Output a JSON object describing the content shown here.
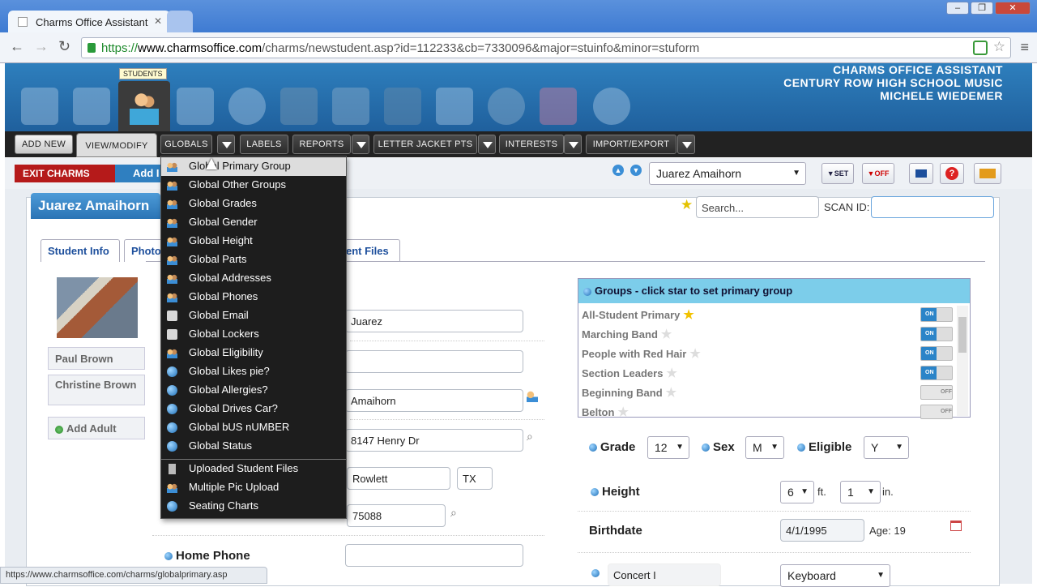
{
  "browser": {
    "tab_title": "Charms Office Assistant",
    "url_scheme": "https://",
    "url_host": "www.charmsoffice.com",
    "url_path": "/charms/newstudent.asp?id=112233&cb=7330096&major=stuinfo&minor=stuform"
  },
  "header": {
    "line1": "CHARMS OFFICE ASSISTANT",
    "line2": "CENTURY ROW HIGH SCHOOL MUSIC",
    "line3": "MICHELE WIEDEMER",
    "tooltip": "STUDENTS"
  },
  "nav": {
    "add_new": "ADD NEW",
    "view_modify": "VIEW/MODIFY",
    "globals": "GLOBALS",
    "labels": "LABELS",
    "reports": "REPORTS",
    "letter_jacket": "LETTER JACKET PTS",
    "interests": "INTERESTS",
    "import_export": "IMPORT/EXPORT"
  },
  "subbar": {
    "exit": "EXIT CHARMS",
    "add": "Add I",
    "student_select": "Juarez Amaihorn",
    "set_label": "SET",
    "off_label": "OFF"
  },
  "student": {
    "name": "Juarez Amaihorn",
    "search_placeholder": "Search...",
    "scan_label": "SCAN ID:"
  },
  "tabs": {
    "student_info": "Student Info",
    "photo": "Photo",
    "files": "ent Files"
  },
  "adults": {
    "a1": "Paul Brown",
    "a2": "Christine Brown",
    "add": "Add Adult"
  },
  "form": {
    "first_name": "Juarez",
    "last_name": "Amaihorn",
    "address": "8147 Henry Dr",
    "city": "Rowlett",
    "state": "TX",
    "zip": "75088",
    "home_phone_label": "Home Phone",
    "grade_label": "Grade",
    "grade": "12",
    "sex_label": "Sex",
    "sex": "M",
    "eligible_label": "Eligible",
    "eligible": "Y",
    "height_label": "Height",
    "height_ft": "6",
    "ft": "ft.",
    "height_in": "1",
    "in": "in.",
    "birthdate_label": "Birthdate",
    "birthdate": "4/1/1995",
    "age": "Age: 19",
    "concert": "Concert I",
    "instrument": "Keyboard"
  },
  "groups": {
    "header": "Groups - click star to set primary group",
    "on": "ON",
    "off": "OFF",
    "items": [
      {
        "name": "All-Student Primary",
        "primary": true,
        "on": true
      },
      {
        "name": "Marching Band",
        "primary": false,
        "on": true
      },
      {
        "name": "People with Red Hair",
        "primary": false,
        "on": true
      },
      {
        "name": "Section Leaders",
        "primary": false,
        "on": true
      },
      {
        "name": "Beginning Band",
        "primary": false,
        "on": false
      },
      {
        "name": "Belton",
        "primary": false,
        "on": false
      }
    ]
  },
  "menu": {
    "items": [
      {
        "label": "Global Primary Group",
        "icon": "group-icon"
      },
      {
        "label": "Global Other Groups",
        "icon": "group-icon"
      },
      {
        "label": "Global Grades",
        "icon": "group-icon"
      },
      {
        "label": "Global Gender",
        "icon": "group-icon"
      },
      {
        "label": "Global Height",
        "icon": "group-icon"
      },
      {
        "label": "Global Parts",
        "icon": "group-icon"
      },
      {
        "label": "Global Addresses",
        "icon": "group-icon"
      },
      {
        "label": "Global Phones",
        "icon": "group-icon"
      },
      {
        "label": "Global Email",
        "icon": "mail-icon"
      },
      {
        "label": "Global Lockers",
        "icon": "mail-icon"
      },
      {
        "label": "Global Eligibility",
        "icon": "group-icon"
      },
      {
        "label": "Global Likes pie?",
        "icon": "pin-icon"
      },
      {
        "label": "Global Allergies?",
        "icon": "pin-icon"
      },
      {
        "label": "Global Drives Car?",
        "icon": "pin-icon"
      },
      {
        "label": "Global bUS nUMBER",
        "icon": "pin-icon"
      },
      {
        "label": "Global Status",
        "icon": "pin-icon"
      },
      {
        "label": "Uploaded Student Files",
        "icon": "file-icon"
      },
      {
        "label": "Multiple Pic Upload",
        "icon": "group-icon"
      },
      {
        "label": "Seating Charts",
        "icon": "pin-icon"
      }
    ]
  },
  "statusbar": "https://www.charmsoffice.com/charms/globalprimary.asp"
}
